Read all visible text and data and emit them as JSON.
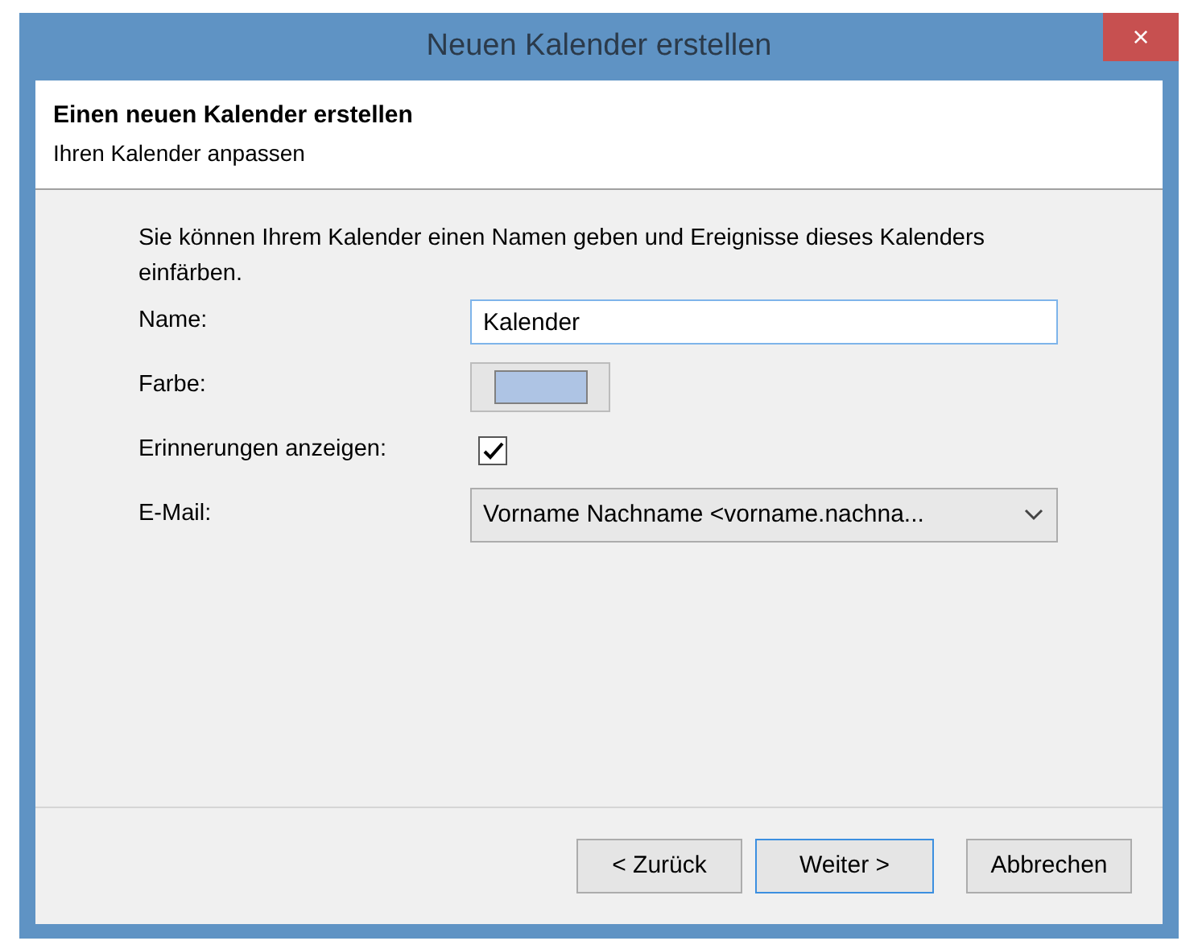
{
  "window": {
    "title": "Neuen Kalender erstellen",
    "close": "×"
  },
  "header": {
    "title": "Einen neuen Kalender erstellen",
    "subtitle": "Ihren Kalender anpassen"
  },
  "intro": "Sie können Ihrem Kalender einen Namen geben und Ereignisse dieses Kalenders einfärben.",
  "fields": [
    {
      "kind": "text",
      "label": "Name:",
      "value": "Kalender"
    },
    {
      "kind": "color",
      "label": "Farbe:",
      "color": "#aec4e4"
    },
    {
      "kind": "checkbox",
      "label": "Erinnerungen anzeigen:",
      "checked": true
    },
    {
      "kind": "select",
      "label": "E-Mail:",
      "value": "Vorname Nachname <vorname.nachna..."
    }
  ],
  "buttons": [
    {
      "label": "< Zurück",
      "selected": false
    },
    {
      "label": "Weiter >",
      "selected": true
    },
    {
      "label": "Abbrechen",
      "selected": false
    }
  ]
}
